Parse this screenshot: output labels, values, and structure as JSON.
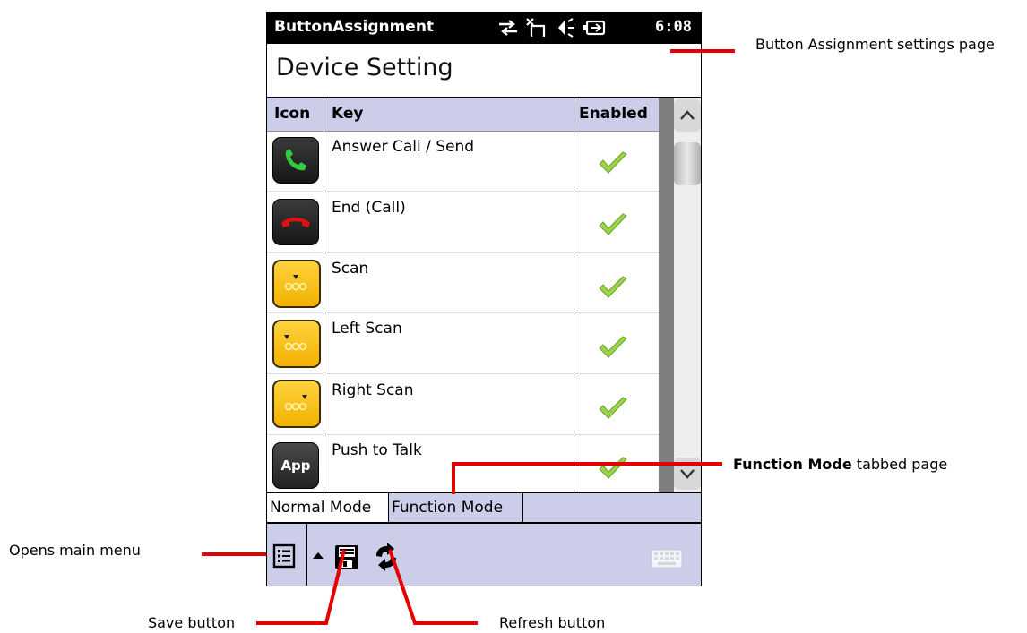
{
  "app": {
    "title": "ButtonAssignment",
    "time": "6:08"
  },
  "page": {
    "title": "Device Setting"
  },
  "table": {
    "columns": [
      "Icon",
      "Key",
      "Enabled"
    ],
    "rows": [
      {
        "icon": "phone-answer-icon",
        "key": "Answer Call / Send",
        "enabled": true
      },
      {
        "icon": "phone-end-icon",
        "key": "End (Call)",
        "enabled": true
      },
      {
        "icon": "scan-icon",
        "key": "Scan",
        "enabled": true
      },
      {
        "icon": "left-scan-icon",
        "key": "Left Scan",
        "enabled": true
      },
      {
        "icon": "right-scan-icon",
        "key": "Right Scan",
        "enabled": true
      },
      {
        "icon": "app-icon",
        "icon_label": "App",
        "key": "Push to Talk",
        "enabled": true
      }
    ]
  },
  "tabs": [
    {
      "label": "Normal Mode",
      "active": true
    },
    {
      "label": "Function Mode",
      "active": false
    }
  ],
  "annotations": {
    "settings_page": "Button Assignment settings page",
    "function_mode_bold": "Function Mode",
    "function_mode_rest": "tabbed page",
    "main_menu": "Opens main menu",
    "save": "Save button",
    "refresh": "Refresh button"
  },
  "colors": {
    "header_bg": "#cbcde9",
    "annotation_line": "#e40000",
    "check_green": "#8fcf3a",
    "icon_yellow": "#f7c21a",
    "answer_green": "#2ecc40",
    "end_red": "#e01010"
  }
}
